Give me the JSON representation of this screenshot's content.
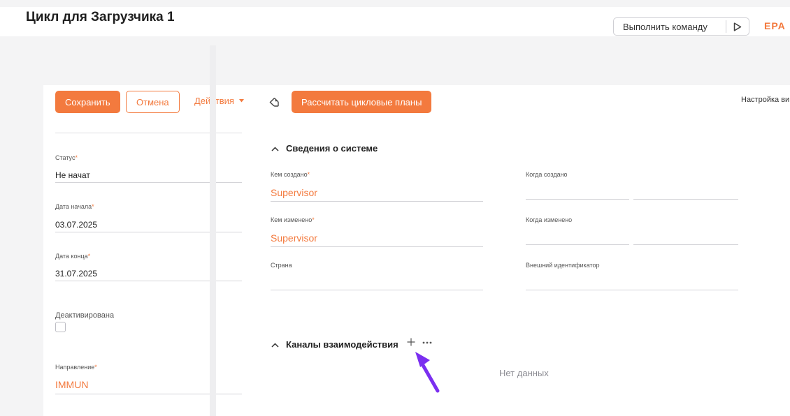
{
  "header": {
    "title": "Цикл для Загрузчика 1",
    "command_placeholder": "Выполнить команду",
    "brand": "EPA"
  },
  "toolbar": {
    "save_label": "Сохранить",
    "cancel_label": "Отмена",
    "actions_label": "Действия",
    "calc_label": "Рассчитать цикловые планы",
    "view_settings_label": "Настройка ви"
  },
  "left": {
    "status": {
      "label": "Статус",
      "required": "*",
      "value": "Не начат"
    },
    "start_date": {
      "label": "Дата начала",
      "required": "*",
      "value": "03.07.2025"
    },
    "end_date": {
      "label": "Дата конца",
      "required": "*",
      "value": "31.07.2025"
    },
    "deactivated": {
      "label": "Деактивирована",
      "checked": false
    },
    "direction": {
      "label": "Направление",
      "required": "*",
      "value": "IMMUN"
    }
  },
  "system_info": {
    "title": "Сведения о системе",
    "created_by": {
      "label": "Кем создано",
      "required": "*",
      "value": "Supervisor"
    },
    "created_at": {
      "label": "Когда создано",
      "value": ""
    },
    "modified_by": {
      "label": "Кем изменено",
      "required": "*",
      "value": "Supervisor"
    },
    "modified_at": {
      "label": "Когда изменено",
      "value": ""
    },
    "country": {
      "label": "Страна",
      "value": ""
    },
    "external_id": {
      "label": "Внешний идентификатор",
      "value": ""
    }
  },
  "channels": {
    "title": "Каналы взаимодействия",
    "empty_text": "Нет данных"
  },
  "colors": {
    "accent": "#f37a3e",
    "annotation_arrow": "#7b2ff0"
  }
}
